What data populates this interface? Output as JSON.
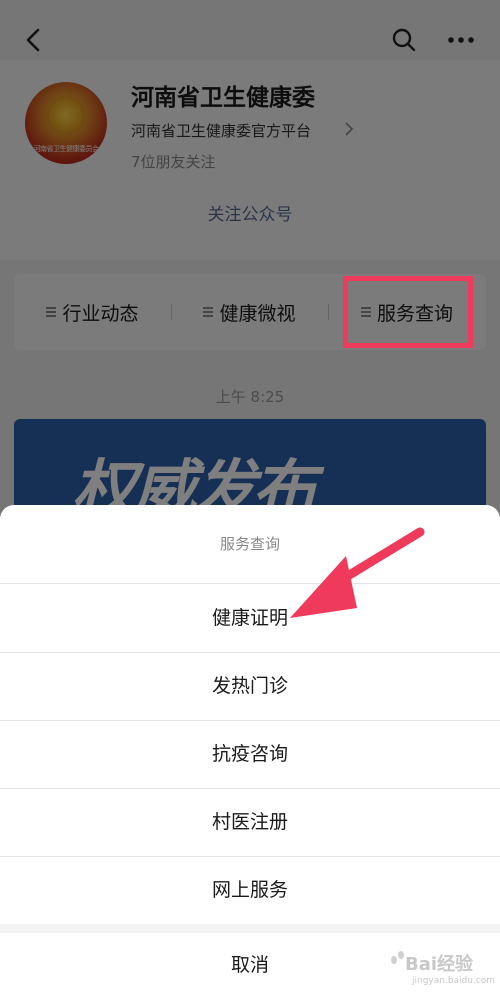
{
  "account": {
    "name": "河南省卫生健康委",
    "subtitle": "河南省卫生健康委官方平台",
    "friends": "7位朋友关注",
    "follow_label": "关注公众号",
    "avatar_text": "河南省卫生健康委员会"
  },
  "menu": {
    "items": [
      {
        "label": "行业动态"
      },
      {
        "label": "健康微视"
      },
      {
        "label": "服务查询"
      }
    ]
  },
  "feed": {
    "time": "上午 8:25",
    "article_banner": "权威发布"
  },
  "sheet": {
    "title": "服务查询",
    "options": [
      {
        "label": "健康证明"
      },
      {
        "label": "发热门诊"
      },
      {
        "label": "抗疫咨询"
      },
      {
        "label": "村医注册"
      },
      {
        "label": "网上服务"
      }
    ],
    "cancel_label": "取消"
  },
  "watermark": {
    "text": "Bai经验",
    "sub": "jingyan.baidu.com"
  },
  "colors": {
    "link": "#576b95",
    "highlight": "#f03a5c",
    "arrow": "#f03a5c",
    "article_bg": "#2c5ea8"
  }
}
